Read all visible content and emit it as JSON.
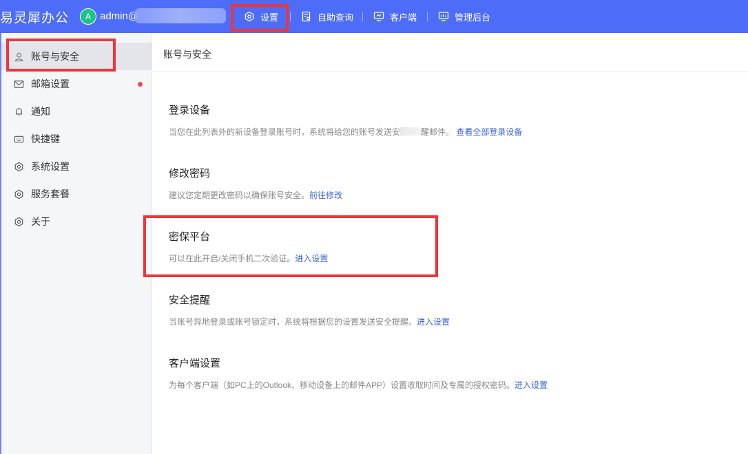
{
  "topbar": {
    "brand": "易灵犀办公",
    "avatar_letter": "A",
    "account": "admin@",
    "nav": [
      {
        "label": "设置",
        "icon": "settings-hex-icon"
      },
      {
        "label": "自助查询",
        "icon": "document-search-icon"
      },
      {
        "label": "客户端",
        "icon": "monitor-icon"
      },
      {
        "label": "管理后台",
        "icon": "dashboard-monitor-icon"
      }
    ]
  },
  "sidebar": {
    "items": [
      {
        "label": "账号与安全",
        "icon": "user-icon",
        "active": true
      },
      {
        "label": "邮箱设置",
        "icon": "mail-icon",
        "badge": "red-dot"
      },
      {
        "label": "通知",
        "icon": "bell-icon"
      },
      {
        "label": "快捷键",
        "icon": "keyboard-icon"
      },
      {
        "label": "系统设置",
        "icon": "settings-hex-icon"
      },
      {
        "label": "服务套餐",
        "icon": "settings-hex-icon"
      },
      {
        "label": "关于",
        "icon": "settings-hex-icon"
      }
    ]
  },
  "main": {
    "title": "账号与安全",
    "sections": [
      {
        "title": "登录设备",
        "desc_a": "当您在此列表外的新设备登录账号时，系统将给您的账号发送安",
        "desc_b": "醒邮件。",
        "link": "查看全部登录设备"
      },
      {
        "title": "修改密码",
        "desc": "建议您定期更改密码以确保账号安全。",
        "link": "前往修改"
      },
      {
        "title": "密保平台",
        "desc": "可以在此开启/关闭手机二次验证。",
        "link": "进入设置"
      },
      {
        "title": "安全提醒",
        "desc": "当账号异地登录或账号锁定时，系统将根据您的设置发送安全提醒。",
        "link": "进入设置"
      },
      {
        "title": "客户端设置",
        "desc": "为每个客户端（如PC上的Outlook、移动设备上的邮件APP）设置收取时间及专属的授权密码。",
        "link": "进入设置"
      }
    ]
  },
  "colors": {
    "topbar": "#4d6cf7",
    "link": "#3a62d6",
    "annotation": "#f0353a",
    "avatar": "#1ec28b"
  }
}
